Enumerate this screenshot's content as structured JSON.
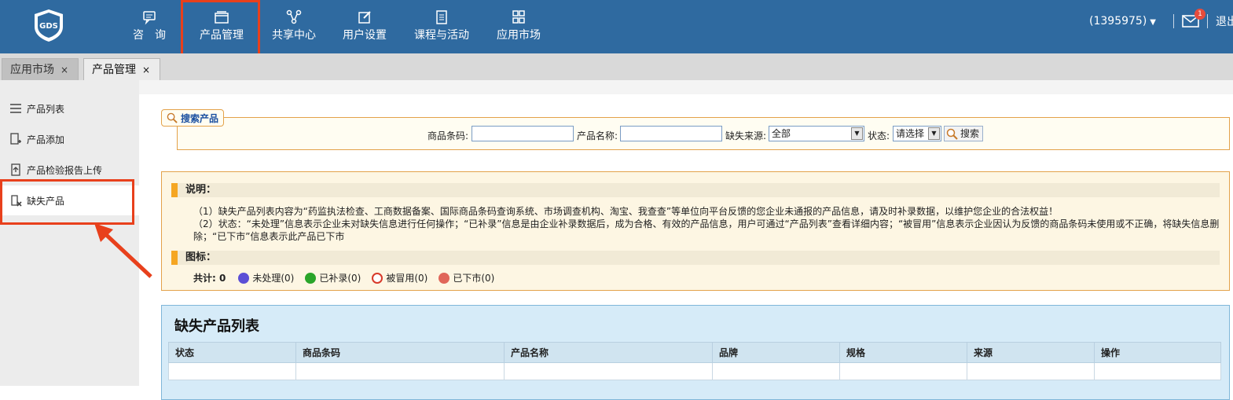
{
  "header": {
    "logo_text": "GDS",
    "nav": [
      {
        "label": "咨　询",
        "icon": "chat-icon"
      },
      {
        "label": "产品管理",
        "icon": "window-icon"
      },
      {
        "label": "共享中心",
        "icon": "share-icon"
      },
      {
        "label": "用户设置",
        "icon": "edit-icon"
      },
      {
        "label": "课程与活动",
        "icon": "document-icon"
      },
      {
        "label": "应用市场",
        "icon": "grid-icon"
      }
    ],
    "user": "(1395975)",
    "mail_count": "1",
    "logout": "退出"
  },
  "tabs": [
    {
      "label": "应用市场",
      "close": "×",
      "active": false
    },
    {
      "label": "产品管理",
      "close": "×",
      "active": true
    }
  ],
  "sidebar": {
    "items": [
      {
        "label": "产品列表",
        "icon": "list-icon"
      },
      {
        "label": "产品添加",
        "icon": "add-doc-icon"
      },
      {
        "label": "产品检验报告上传",
        "icon": "upload-doc-icon"
      },
      {
        "label": "缺失产品",
        "icon": "missing-doc-icon"
      }
    ]
  },
  "search": {
    "legend": "搜索产品",
    "barcode_label": "商品条码:",
    "barcode_value": "",
    "name_label": "产品名称:",
    "name_value": "",
    "source_label": "缺失来源:",
    "source_value": "全部",
    "status_label": "状态:",
    "status_value": "请选择",
    "button": "搜索"
  },
  "notice": {
    "heading1": "说明：",
    "line1": "（1）缺失产品列表内容为“药监执法检查、工商数据备案、国际商品条码查询系统、市场调查机构、淘宝、我查查”等单位向平台反馈的您企业未通报的产品信息，请及时补录数据，以维护您企业的合法权益！",
    "line2": "（2）状态：“未处理”信息表示企业未对缺失信息进行任何操作；“已补录”信息是由企业补录数据后，成为合格、有效的产品信息，用户可通过“产品列表”查看详细内容；“被冒用”信息表示企业因认为反馈的商品条码未使用或不正确，将缺失信息删除；“已下市”信息表示此产品已下市",
    "heading2": "图标：",
    "total": "共计: 0",
    "legend": [
      {
        "label": "未处理(0)",
        "color": "#5b4fd6"
      },
      {
        "label": "已补录(0)",
        "color": "#2aa52a"
      },
      {
        "label": "被冒用(0)",
        "color": "#d83a2a"
      },
      {
        "label": "已下市(0)",
        "color": "#e0665a"
      }
    ]
  },
  "list": {
    "title": "缺失产品列表",
    "columns": [
      "状态",
      "商品条码",
      "产品名称",
      "品牌",
      "规格",
      "来源",
      "操作"
    ]
  },
  "colors": {
    "header_bg": "#2f6aa0",
    "highlight": "#e8401c",
    "panel_border": "#e3a24a"
  }
}
